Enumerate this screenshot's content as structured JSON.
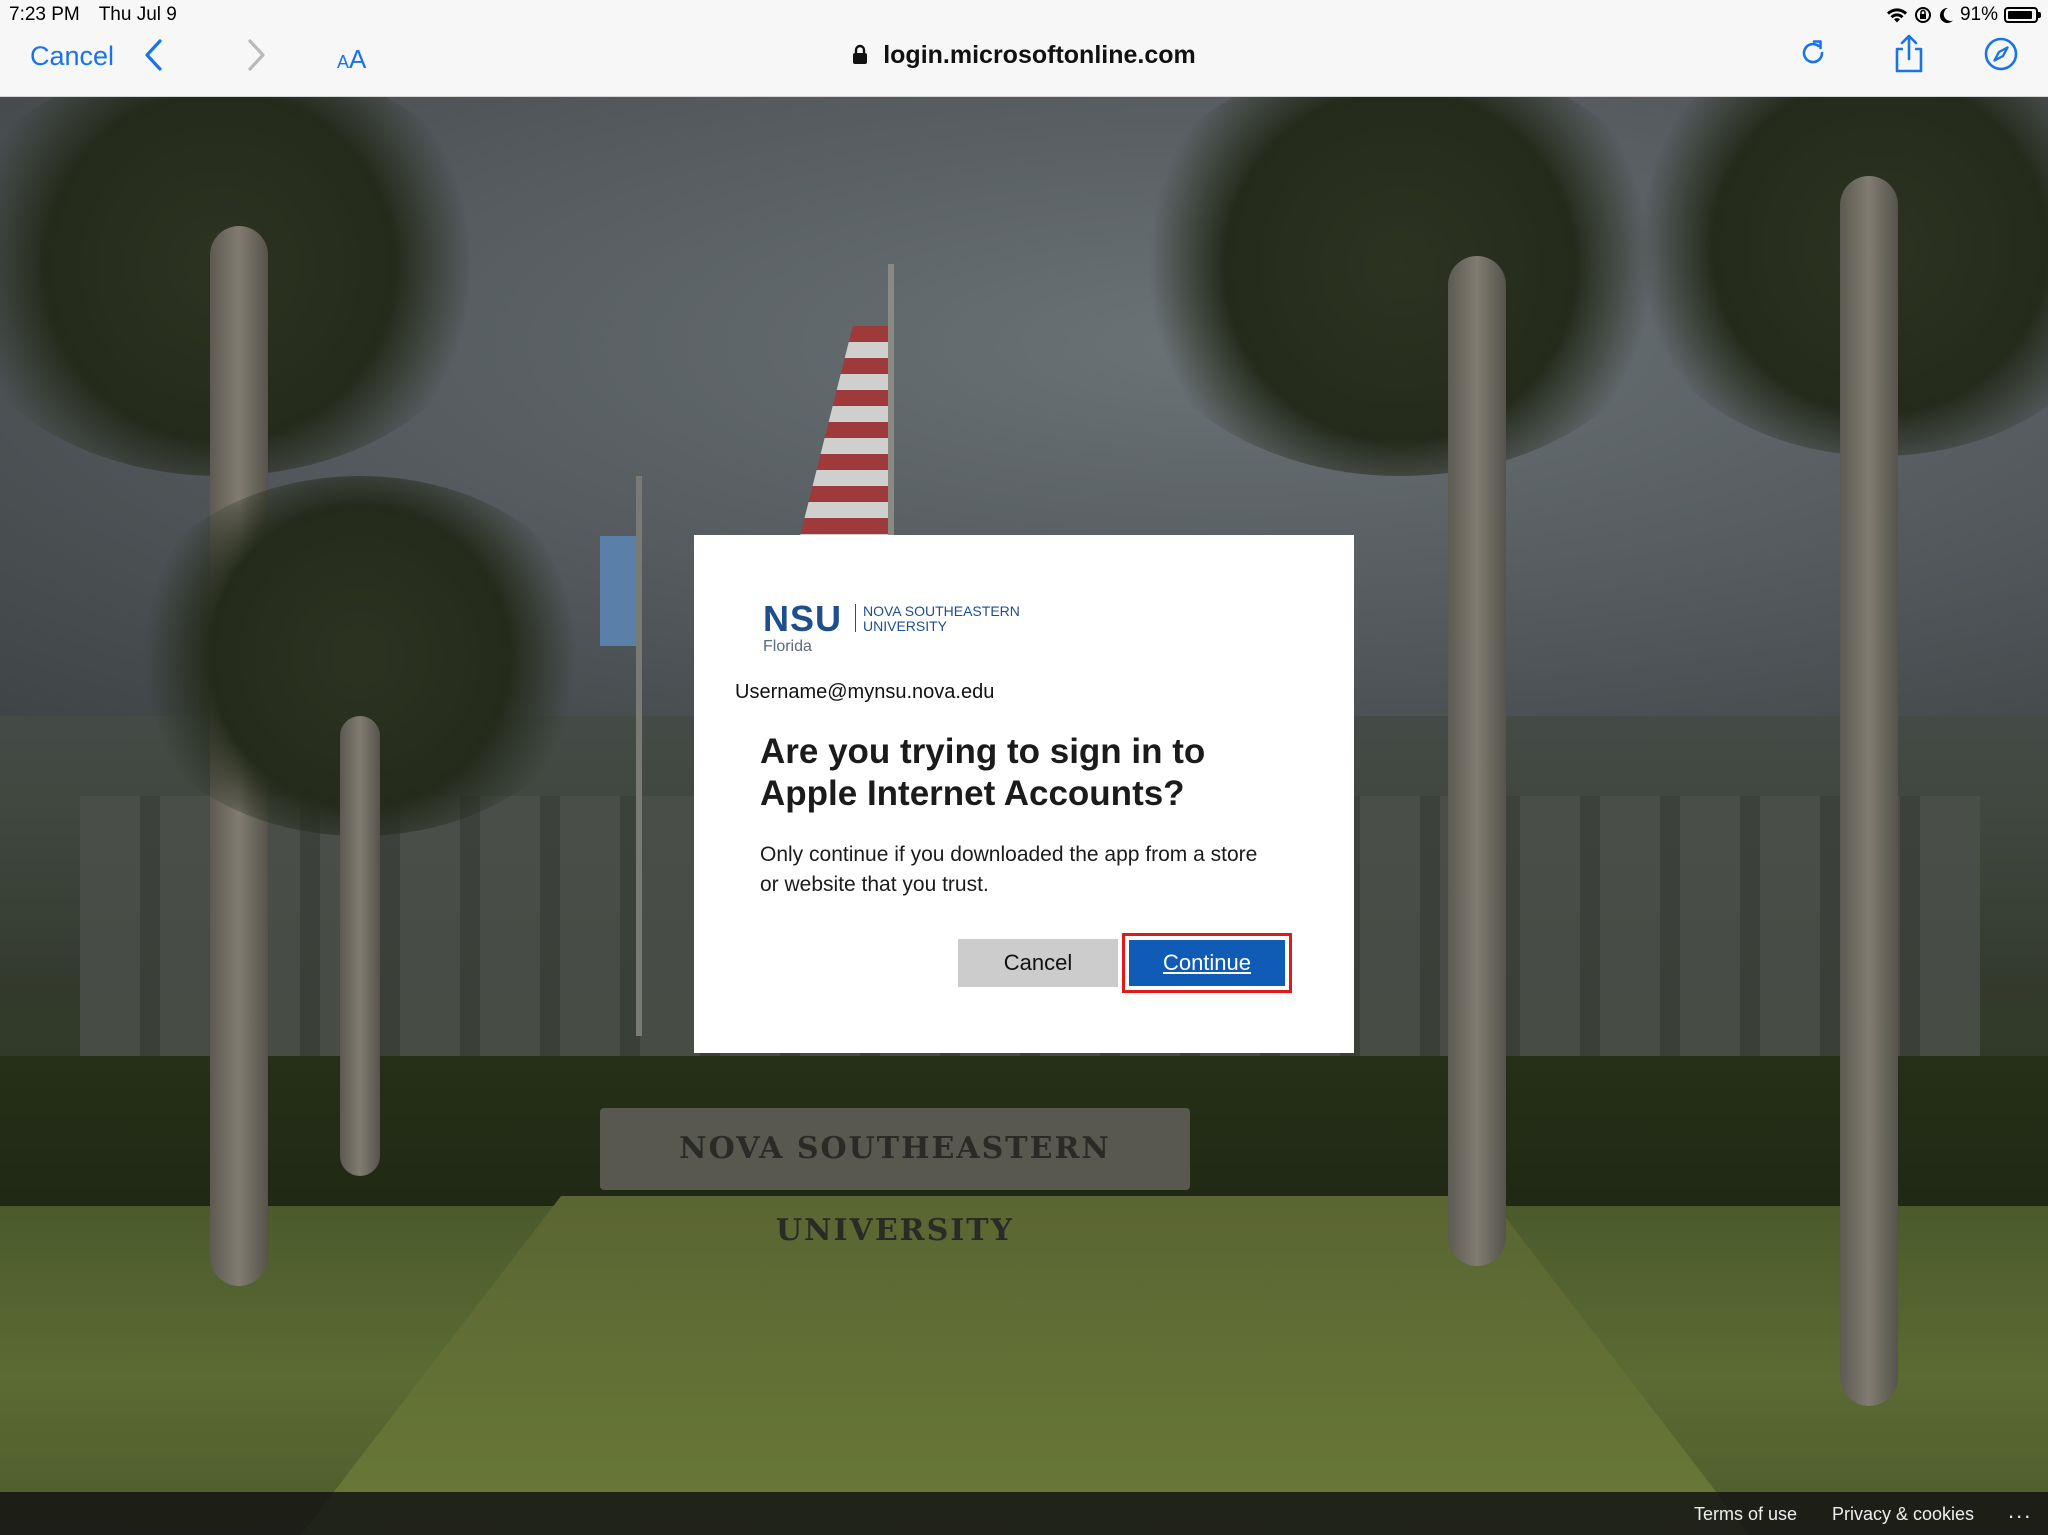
{
  "status_bar": {
    "time": "7:23 PM",
    "date": "Thu Jul 9",
    "battery": "91%",
    "battery_level": 0.91
  },
  "browser": {
    "cancel_label": "Cancel",
    "aa_label": "AA",
    "url": "login.microsoftonline.com",
    "icons": [
      "back-icon",
      "forward-icon",
      "lock-icon",
      "reload-icon",
      "share-icon",
      "compass-icon"
    ]
  },
  "background": {
    "sign_text": "NOVA SOUTHEASTERN UNIVERSITY"
  },
  "dialog": {
    "logo": {
      "mark": "NSU",
      "sub": "Florida",
      "name_line1": "NOVA SOUTHEASTERN",
      "name_line2": "UNIVERSITY"
    },
    "username": "Username@mynsu.nova.edu",
    "title": "Are you trying to sign in to Apple Internet Accounts?",
    "description": "Only continue if you downloaded the app from a store or website that you trust.",
    "cancel_label": "Cancel",
    "continue_label": "Continue",
    "accent_color": "#0f5bb5",
    "highlight_color": "#e01a1a"
  },
  "footer": {
    "terms": "Terms of use",
    "privacy": "Privacy & cookies",
    "more": "..."
  }
}
